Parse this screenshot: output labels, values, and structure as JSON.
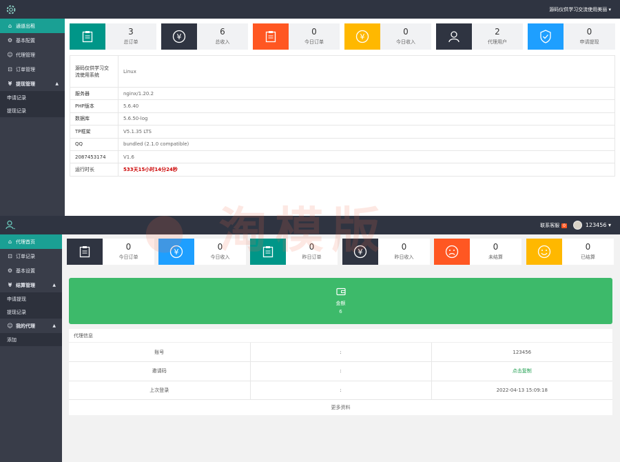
{
  "admin": {
    "topbar": {
      "user_label": "源码仪供学习交流使用美丽 ▾"
    },
    "sidebar": [
      {
        "label": "通道出租",
        "icon": "home-icon",
        "glyph": "⌂",
        "active": true
      },
      {
        "label": "基本配置",
        "icon": "gear-icon",
        "glyph": "⚙"
      },
      {
        "label": "代理管理",
        "icon": "user-icon",
        "glyph": "☺"
      },
      {
        "label": "订单管理",
        "icon": "cart-icon",
        "glyph": "⊡"
      },
      {
        "label": "提现管理",
        "icon": "yen-icon",
        "glyph": "¥",
        "parent": true
      }
    ],
    "sidebar_sub": [
      {
        "label": "申请记录"
      },
      {
        "label": "提现记录"
      }
    ],
    "cards": [
      {
        "num": "3",
        "label": "总订单",
        "color": "#009688",
        "icon": "clipboard-icon"
      },
      {
        "num": "6",
        "label": "总收入",
        "color": "#2f3441",
        "icon": "yen-icon"
      },
      {
        "num": "0",
        "label": "今日订单",
        "color": "#ff5722",
        "icon": "clipboard-icon"
      },
      {
        "num": "0",
        "label": "今日收入",
        "color": "#ffb800",
        "icon": "yen-icon"
      },
      {
        "num": "2",
        "label": "代理用户",
        "color": "#2f3441",
        "icon": "users-icon"
      },
      {
        "num": "0",
        "label": "申请提现",
        "color": "#1e9fff",
        "icon": "shield-icon"
      }
    ],
    "info": [
      {
        "k": "源码仅供学习交流使用系统",
        "v": "Linux"
      },
      {
        "k": "服务器",
        "v": "nginx/1.20.2"
      },
      {
        "k": "PHP版本",
        "v": "5.6.40"
      },
      {
        "k": "数据库",
        "v": "5.6.50-log"
      },
      {
        "k": "TP框架",
        "v": "V5.1.35 LTS"
      },
      {
        "k": "QQ",
        "v": "bundled (2.1.0 compatible)"
      },
      {
        "k": "2087453174",
        "v": "V1.6"
      },
      {
        "k": "运行时长",
        "v": "533天15小时14分24秒"
      }
    ]
  },
  "agent": {
    "topbar": {
      "contact_label": "联系客服",
      "contact_badge": "0",
      "username": "123456 ▾"
    },
    "sidebar": [
      {
        "label": "代理首页",
        "icon": "home-icon",
        "glyph": "⌂",
        "active": true
      },
      {
        "label": "订单记录",
        "icon": "cart-icon",
        "glyph": "⊡"
      },
      {
        "label": "基本设置",
        "icon": "gear-icon",
        "glyph": "⚙"
      },
      {
        "label": "结算管理",
        "icon": "yen-icon",
        "glyph": "¥",
        "parent": true
      }
    ],
    "sidebar_sub1": [
      {
        "label": "申请提现"
      },
      {
        "label": "提现记录"
      }
    ],
    "sidebar_parent2": {
      "label": "我的代理",
      "icon": "user-icon",
      "glyph": "☺"
    },
    "sidebar_sub2": [
      {
        "label": "添加"
      }
    ],
    "cards": [
      {
        "num": "0",
        "label": "今日订单",
        "color": "#2f3441",
        "icon": "clipboard-icon"
      },
      {
        "num": "0",
        "label": "今日收入",
        "color": "#1e9fff",
        "icon": "yen-icon"
      },
      {
        "num": "0",
        "label": "昨日订单",
        "color": "#009688",
        "icon": "clipboard-icon"
      },
      {
        "num": "0",
        "label": "昨日收入",
        "color": "#2f3441",
        "icon": "yen-icon"
      },
      {
        "num": "0",
        "label": "未结算",
        "color": "#ff5722",
        "icon": "sad-face-icon"
      },
      {
        "num": "0",
        "label": "已结算",
        "color": "#ffb800",
        "icon": "smile-face-icon"
      }
    ],
    "balance": {
      "title": "金额",
      "value": "6"
    },
    "panel_title": "代理信息",
    "rows": [
      {
        "k": "账号",
        "sep": ":",
        "v": "123456"
      },
      {
        "k": "邀请码",
        "sep": ":",
        "v": "点击复制"
      },
      {
        "k": "上次登录",
        "sep": ":",
        "v": "2022-04-13 15:09:18"
      }
    ],
    "more_label": "更多资料"
  }
}
